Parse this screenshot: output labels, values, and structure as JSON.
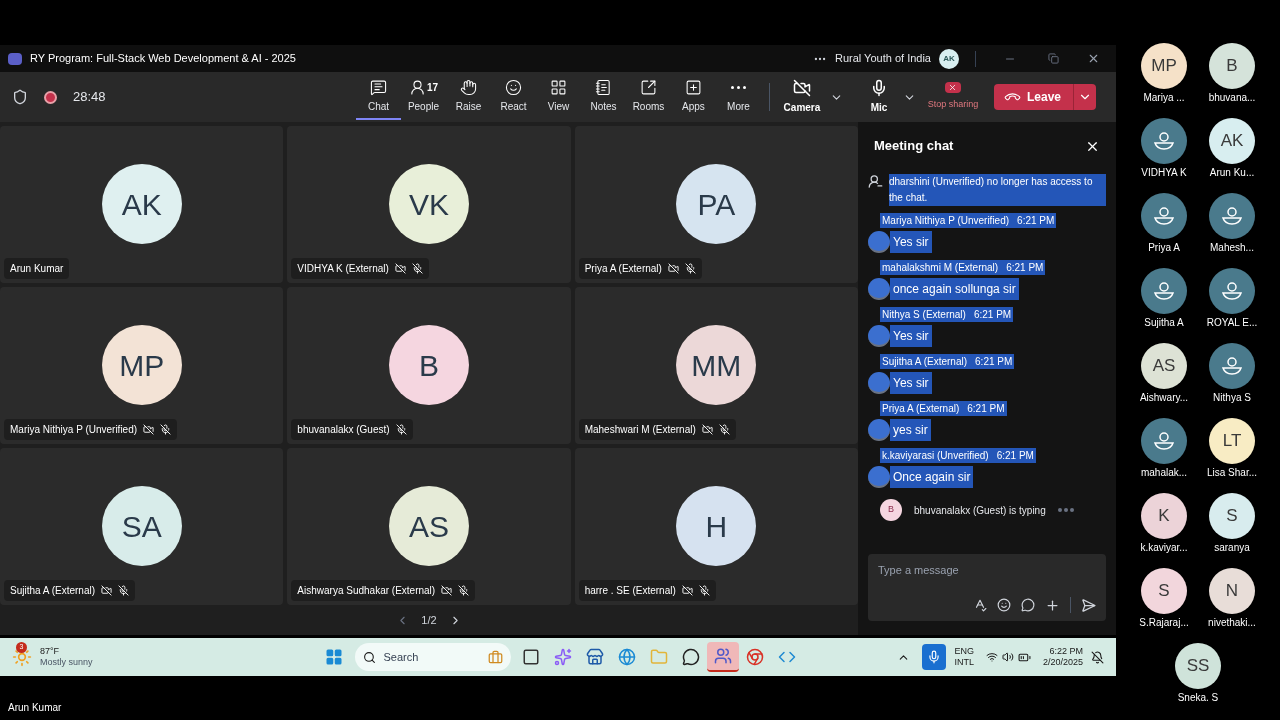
{
  "window": {
    "title": "RY Program: Full-Stack Web Development & AI - 2025",
    "org": "Rural Youth of India",
    "account_initials": "AK"
  },
  "meeting": {
    "timer": "28:48",
    "recording": true
  },
  "toolbar": [
    {
      "kind": "chat",
      "label": "Chat",
      "selected": true
    },
    {
      "kind": "people",
      "label": "People",
      "count": "17",
      "selected": false
    },
    {
      "kind": "raise",
      "label": "Raise",
      "selected": false
    },
    {
      "kind": "react",
      "label": "React",
      "selected": false
    },
    {
      "kind": "view",
      "label": "View",
      "selected": false
    },
    {
      "kind": "notes",
      "label": "Notes",
      "selected": false
    },
    {
      "kind": "rooms",
      "label": "Rooms",
      "selected": false
    },
    {
      "kind": "apps",
      "label": "Apps",
      "selected": false
    },
    {
      "kind": "more",
      "label": "More",
      "selected": false
    }
  ],
  "controls": {
    "camera": {
      "label": "Camera",
      "on": false
    },
    "mic": {
      "label": "Mic",
      "on": true
    },
    "share": {
      "label": "Stop sharing"
    },
    "leave": {
      "label": "Leave"
    }
  },
  "tiles": [
    {
      "initials": "AK",
      "name": "Arun Kumar",
      "color": "#dff0f0",
      "camera_off": false,
      "muted": false
    },
    {
      "initials": "VK",
      "name": "VIDHYA K (External)",
      "color": "#e8efd9",
      "camera_off": true,
      "muted": true
    },
    {
      "initials": "PA",
      "name": "Priya A (External)",
      "color": "#d6e4f0",
      "camera_off": true,
      "muted": true
    },
    {
      "initials": "MP",
      "name": "Mariya Nithiya P (Unverified)",
      "color": "#f3e3d6",
      "camera_off": true,
      "muted": true
    },
    {
      "initials": "B",
      "name": "bhuvanalakx (Guest)",
      "color": "#f5d6e0",
      "camera_off": false,
      "muted": true
    },
    {
      "initials": "MM",
      "name": "Maheshwari M (External)",
      "color": "#ecd8d8",
      "camera_off": true,
      "muted": true
    },
    {
      "initials": "SA",
      "name": "Sujitha A (External)",
      "color": "#d8ecea",
      "camera_off": true,
      "muted": true
    },
    {
      "initials": "AS",
      "name": "Aishwarya Sudhakar (External)",
      "color": "#e6ebd8",
      "camera_off": true,
      "muted": true
    },
    {
      "initials": "H",
      "name": "harre . SE (External)",
      "color": "#d6e2f0",
      "camera_off": true,
      "muted": true
    }
  ],
  "pager": "1/2",
  "chat": {
    "title": "Meeting chat",
    "messages": [
      {
        "kind": "system",
        "text": "dharshini (Unverified) no longer has access to the chat."
      },
      {
        "kind": "message",
        "sender": "Mariya Nithiya P (Unverified)",
        "time": "6:21 PM",
        "text": "Yes sir"
      },
      {
        "kind": "message",
        "sender": "mahalakshmi M (External)",
        "time": "6:21 PM",
        "text": "once again sollunga sir"
      },
      {
        "kind": "message",
        "sender": "Nithya S (External)",
        "time": "6:21 PM",
        "text": "Yes sir"
      },
      {
        "kind": "message",
        "sender": "Sujitha A (External)",
        "time": "6:21 PM",
        "text": "Yes sir"
      },
      {
        "kind": "message",
        "sender": "Priya A (External)",
        "time": "6:21 PM",
        "text": "yes sir"
      },
      {
        "kind": "message",
        "sender": "k.kaviyarasi (Unverified)",
        "time": "6:21 PM",
        "text": "Once again sir"
      }
    ],
    "typing": {
      "initials": "B",
      "text": "bhuvanalakx (Guest) is typing"
    },
    "input": {
      "placeholder": "Type a message"
    }
  },
  "participants": [
    {
      "name": "Mariya ...",
      "initials": "MP",
      "color": "#f5e1c8"
    },
    {
      "name": "bhuvana...",
      "initials": "B",
      "color": "#d5e3da"
    },
    {
      "name": "VIDHYA K",
      "color": "#4a7a8c"
    },
    {
      "name": "Arun Ku...",
      "initials": "AK",
      "color": "#d8eef0"
    },
    {
      "name": "Priya A",
      "color": "#4a7a8c"
    },
    {
      "name": "Mahesh...",
      "color": "#4a7a8c"
    },
    {
      "name": "Sujitha A",
      "color": "#4a7a8c"
    },
    {
      "name": "ROYAL E...",
      "color": "#4a7a8c"
    },
    {
      "name": "Aishwary...",
      "initials": "AS",
      "color": "#dde2d5"
    },
    {
      "name": "Nithya S",
      "color": "#4a7a8c"
    },
    {
      "name": "mahalak...",
      "color": "#4a7a8c"
    },
    {
      "name": "Lisa Shar...",
      "initials": "LT",
      "color": "#f8ecc4"
    },
    {
      "name": "k.kaviyar...",
      "initials": "K",
      "color": "#ecd3d8"
    },
    {
      "name": "saranya",
      "initials": "S",
      "color": "#d8ecee"
    },
    {
      "name": "S.Rajaraj...",
      "initials": "S",
      "color": "#f2d6dc"
    },
    {
      "name": "nivethaki...",
      "initials": "N",
      "color": "#e8ddd8"
    },
    {
      "name": "Sneka. S",
      "initials": "SS",
      "color": "#cfe3da"
    }
  ],
  "taskbar": {
    "weather": {
      "badge": "3",
      "temp": "87°F",
      "condition": "Mostly sunny"
    },
    "search": {
      "placeholder": "Search"
    },
    "apps": [
      {
        "kind": "taskview",
        "selected": false
      },
      {
        "kind": "copilot",
        "selected": false
      },
      {
        "kind": "store",
        "selected": false
      },
      {
        "kind": "edge",
        "selected": false
      },
      {
        "kind": "files",
        "selected": false
      },
      {
        "kind": "whatsapp",
        "selected": false
      },
      {
        "kind": "teams",
        "selected": true
      },
      {
        "kind": "chrome",
        "selected": false
      },
      {
        "kind": "vscode",
        "selected": false
      }
    ],
    "language": [
      "ENG",
      "INTL"
    ],
    "time": "6:22 PM",
    "date": "2/20/2025"
  },
  "presenter": "Arun Kumar"
}
